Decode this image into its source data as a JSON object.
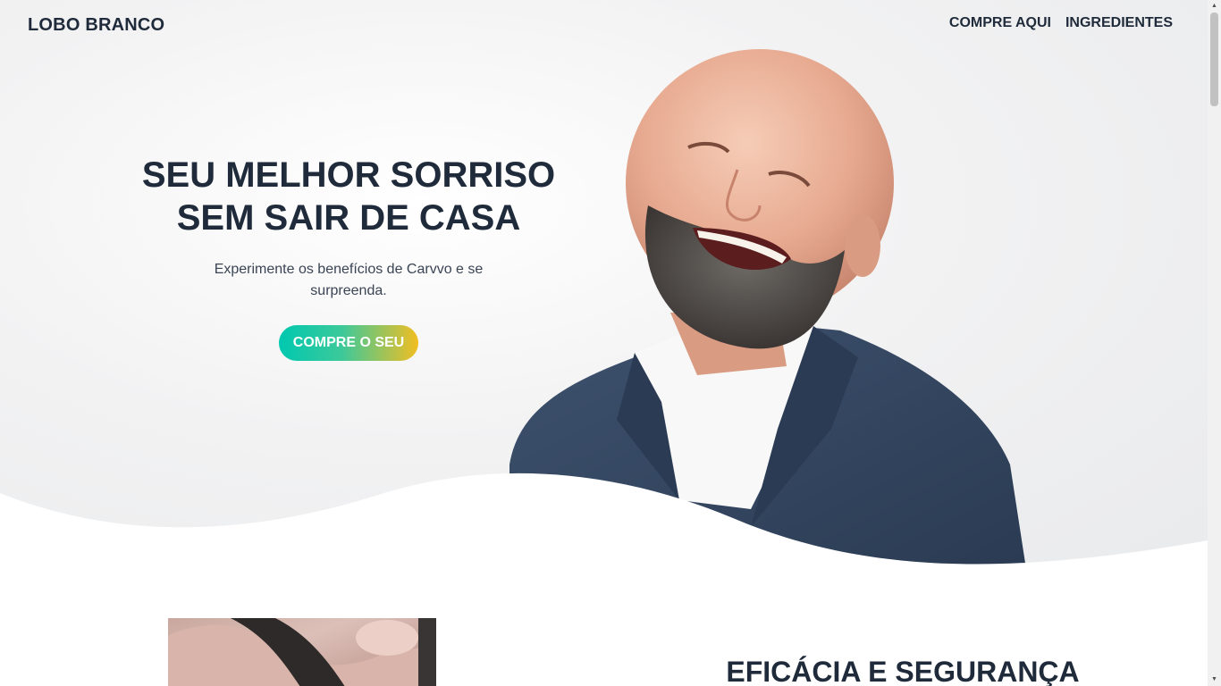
{
  "brand": "LOBO BRANCO",
  "nav": {
    "items": [
      "COMPRE AQUI",
      "INGREDIENTES"
    ]
  },
  "hero": {
    "title_line1": "SEU MELHOR SORRISO",
    "title_line2": "SEM SAIR DE CASA",
    "subtitle": "Experimente os benefícios de Carvvo e se surpreenda.",
    "cta_label": "COMPRE O SEU",
    "image_icon": "smiling-man-photo"
  },
  "section2": {
    "title": "EFICÁCIA E SEGURANÇA",
    "image_icon": "hand-holding-product-photo"
  },
  "colors": {
    "text": "#1f2a3a",
    "cta_gradient_start": "#00c8b0",
    "cta_gradient_end": "#f2be22",
    "suit": "#34465f",
    "skin": "#e7aa90"
  }
}
